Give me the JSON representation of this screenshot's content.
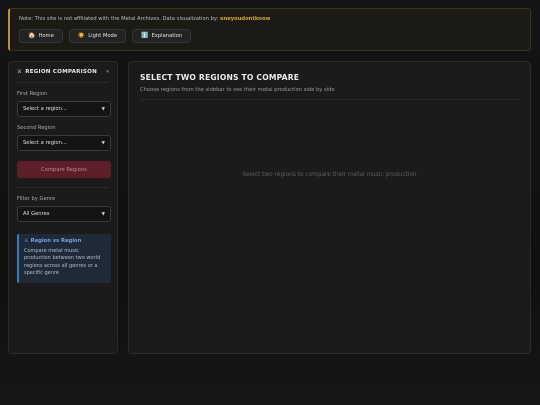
{
  "notice": {
    "prefix": "Note: This site is not affiliated with the Metal Archives. Data visualization by: ",
    "author": "oneyoudontknow",
    "accent": "#b8962a"
  },
  "nav": [
    {
      "icon": "🏠",
      "icon_name": "home-icon",
      "label": "Home"
    },
    {
      "icon": "☀️",
      "icon_name": "sun-icon",
      "label": "Light Mode"
    },
    {
      "icon": "ℹ️",
      "icon_name": "info-icon",
      "label": "Explanation"
    }
  ],
  "sidebar": {
    "icon": "⚔",
    "title": "REGION COMPARISON",
    "collapse_icon": "▾",
    "first_region": {
      "label": "First Region",
      "value": "Select a region..."
    },
    "second_region": {
      "label": "Second Region",
      "value": "Select a region..."
    },
    "compare_label": "Compare Regions",
    "genre": {
      "label": "Filter by Genre",
      "value": "All Genres"
    },
    "info": {
      "icon": "⚔",
      "title": "Region vs Region",
      "body": "Compare metal music production between two world regions across all genres or a specific genre"
    }
  },
  "main": {
    "title": "SELECT TWO REGIONS TO COMPARE",
    "subtitle": "Choose regions from the sidebar to see their metal production side by side",
    "placeholder": "Select two regions to compare their metal music production"
  },
  "colors": {
    "compare_button": "#5e1e28",
    "info_accent": "#3c79c4"
  }
}
